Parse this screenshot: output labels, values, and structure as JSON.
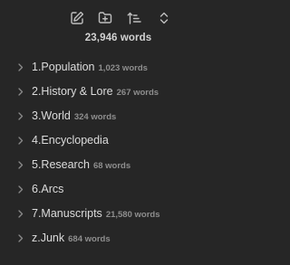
{
  "toolbar": {
    "buttons": [
      {
        "name": "new-note-button",
        "icon": "pencil-square-icon"
      },
      {
        "name": "new-folder-button",
        "icon": "folder-plus-icon"
      },
      {
        "name": "sort-button",
        "icon": "sort-ascending-icon"
      },
      {
        "name": "collapse-expand-button",
        "icon": "chevrons-up-down-icon"
      }
    ]
  },
  "total_words": "23,946 words",
  "folders": [
    {
      "label": "1.Population",
      "count": "1,023 words"
    },
    {
      "label": "2.History & Lore",
      "count": "267 words"
    },
    {
      "label": "3.World",
      "count": "324 words"
    },
    {
      "label": "4.Encyclopedia",
      "count": ""
    },
    {
      "label": "5.Research",
      "count": "68 words"
    },
    {
      "label": "6.Arcs",
      "count": ""
    },
    {
      "label": "7.Manuscripts",
      "count": "21,580 words"
    },
    {
      "label": "z.Junk",
      "count": "684 words"
    }
  ],
  "colors": {
    "background": "#262626",
    "text": "#dcdcdc",
    "muted": "#8e8e8e",
    "icon": "#bfbfbf"
  }
}
